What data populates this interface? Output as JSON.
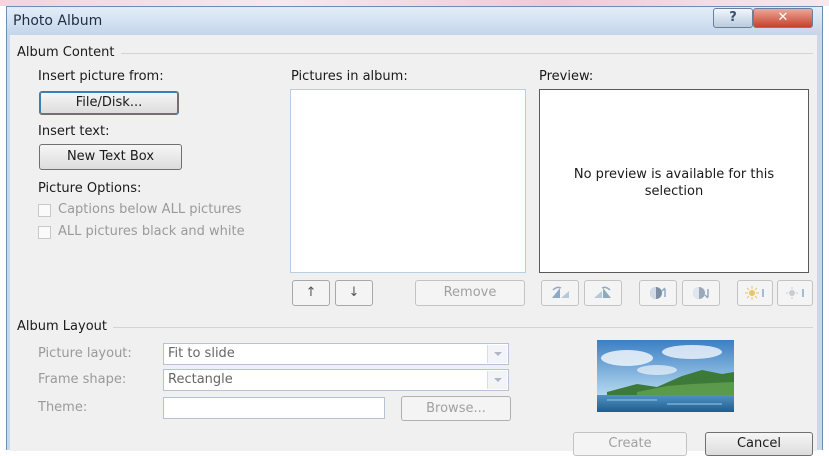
{
  "window": {
    "title": "Photo Album",
    "help_label": "?",
    "close_label": "✕"
  },
  "album_content": {
    "legend": "Album Content",
    "insert_picture_label": "Insert picture from:",
    "file_disk_button": "File/Disk...",
    "insert_text_label": "Insert text:",
    "new_text_box_button": "New Text Box",
    "picture_options_label": "Picture Options:",
    "captions_below_label": "Captions below ALL pictures",
    "black_white_label": "ALL pictures black and white",
    "pictures_in_album_label": "Pictures in album:",
    "move_up_label": "↑",
    "move_down_label": "↓",
    "remove_button": "Remove",
    "preview_label": "Preview:",
    "no_preview_text": "No preview is available for this selection"
  },
  "preview_tools": [
    "rotate-left-icon",
    "rotate-right-icon",
    "contrast-up-icon",
    "contrast-down-icon",
    "brightness-up-icon",
    "brightness-down-icon"
  ],
  "album_layout": {
    "legend": "Album Layout",
    "picture_layout_label": "Picture layout:",
    "picture_layout_value": "Fit to slide",
    "frame_shape_label": "Frame shape:",
    "frame_shape_value": "Rectangle",
    "theme_label": "Theme:",
    "theme_value": "",
    "browse_button": "Browse..."
  },
  "footer": {
    "create_button": "Create",
    "cancel_button": "Cancel"
  }
}
